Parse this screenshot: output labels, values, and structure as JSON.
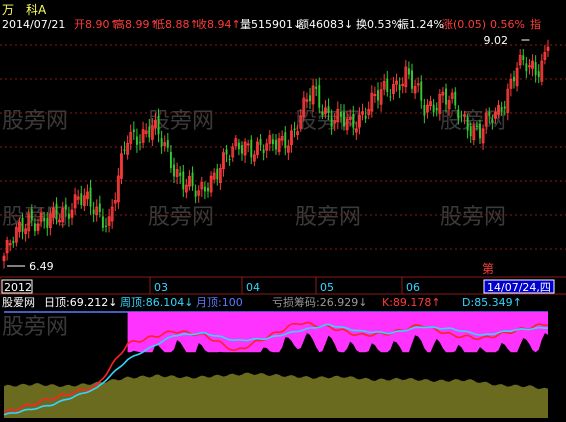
{
  "window": {
    "app_glyph": "万",
    "title": "科A"
  },
  "header": {
    "date": "2014/07/21",
    "items": [
      {
        "label": "开",
        "value": "8.90",
        "arrow": "↑",
        "color": "#ff3b3b"
      },
      {
        "label": "高",
        "value": "8.99",
        "arrow": "↑",
        "color": "#ff3b3b"
      },
      {
        "label": "低",
        "value": "8.88",
        "arrow": "↑",
        "color": "#ff3b3b"
      },
      {
        "label": "收",
        "value": "8.94",
        "arrow": "↑",
        "color": "#ff3b3b"
      },
      {
        "label": "量",
        "value": "515901",
        "arrow": "↓",
        "color": "#ffffff"
      },
      {
        "label": "额",
        "value": "46083",
        "arrow": "↓",
        "color": "#ffffff"
      },
      {
        "label": "换",
        "value": "0.53%",
        "arrow": "",
        "color": "#ffffff"
      },
      {
        "label": "振",
        "value": "1.24%",
        "arrow": "",
        "color": "#ffffff"
      },
      {
        "label": "涨",
        "value": "(0.05)",
        "arrow": "",
        "color": "#ff3b3b"
      },
      {
        "label": "",
        "value": "0.56%",
        "arrow": "",
        "color": "#ff3b3b"
      },
      {
        "label": "指",
        "value": "",
        "arrow": "",
        "color": "#ff3b3b"
      }
    ]
  },
  "price_panel": {
    "high_label": "9.02",
    "low_label": "6.49",
    "watermark": "股旁网"
  },
  "time_axis": {
    "labels": [
      {
        "text": "2012",
        "boxed": true
      },
      {
        "text": "03",
        "boxed": false
      },
      {
        "text": "04",
        "boxed": false
      },
      {
        "text": "05",
        "boxed": false
      },
      {
        "text": "06",
        "boxed": false
      }
    ],
    "marker": "第",
    "cursor_date": "14/07/24,四"
  },
  "indicator_header": {
    "name": "股爱网",
    "items": [
      {
        "label": "日顶:",
        "value": "69.212",
        "arrow": "↓",
        "color": "#ffffff"
      },
      {
        "label": "周顶:",
        "value": "86.104",
        "arrow": "↓",
        "color": "#33d6ff"
      },
      {
        "label": "月顶:",
        "value": "100",
        "arrow": "",
        "color": "#5a7bff"
      },
      {
        "label": "亏损筹码:",
        "value": "26.929",
        "arrow": "↓",
        "color": "#9a9a9a"
      },
      {
        "label": "K:",
        "value": "89.178",
        "arrow": "↑",
        "color": "#ff3b3b"
      },
      {
        "label": "D:",
        "value": "85.349",
        "arrow": "↑",
        "color": "#33d6ff"
      }
    ]
  },
  "colors": {
    "background": "#000000",
    "up_candle": "#ff3b3b",
    "down_candle": "#33cc33",
    "grid": "#8b1a1a",
    "axis": "#8b1a1a",
    "k_line": "#ff2222",
    "d_line": "#33d6ff",
    "magenta_area": "#ff33ff",
    "yellow_band": "#ffff00",
    "olive_area": "#6b6b1f",
    "top_line": "#5a7bff",
    "watermark": "#3a3a3a"
  },
  "chart_data": {
    "type": "candlestick",
    "period": "daily",
    "price_range": [
      6.49,
      9.02
    ],
    "anchor_points": [
      {
        "i": 0,
        "close": 6.6
      },
      {
        "i": 8,
        "close": 7.05
      },
      {
        "i": 14,
        "close": 6.95
      },
      {
        "i": 24,
        "close": 7.25
      },
      {
        "i": 34,
        "close": 7.0
      },
      {
        "i": 40,
        "close": 7.9
      },
      {
        "i": 48,
        "close": 8.05
      },
      {
        "i": 55,
        "close": 7.6
      },
      {
        "i": 63,
        "close": 7.25
      },
      {
        "i": 70,
        "close": 7.65
      },
      {
        "i": 78,
        "close": 7.85
      },
      {
        "i": 86,
        "close": 7.8
      },
      {
        "i": 94,
        "close": 8.0
      },
      {
        "i": 100,
        "close": 8.45
      },
      {
        "i": 106,
        "close": 8.15
      },
      {
        "i": 112,
        "close": 8.05
      },
      {
        "i": 118,
        "close": 8.3
      },
      {
        "i": 124,
        "close": 8.45
      },
      {
        "i": 130,
        "close": 8.65
      },
      {
        "i": 136,
        "close": 8.25
      },
      {
        "i": 142,
        "close": 8.4
      },
      {
        "i": 148,
        "close": 8.15
      },
      {
        "i": 154,
        "close": 8.0
      },
      {
        "i": 160,
        "close": 8.2
      },
      {
        "i": 166,
        "close": 8.75
      },
      {
        "i": 172,
        "close": 8.65
      },
      {
        "i": 176,
        "close": 8.94
      }
    ],
    "indicator": {
      "name": "股爱网",
      "scale": [
        0,
        100
      ],
      "k_line": [
        {
          "i": 0,
          "v": 5
        },
        {
          "i": 15,
          "v": 18
        },
        {
          "i": 30,
          "v": 30
        },
        {
          "i": 40,
          "v": 70
        },
        {
          "i": 55,
          "v": 82
        },
        {
          "i": 65,
          "v": 78
        },
        {
          "i": 75,
          "v": 63
        },
        {
          "i": 85,
          "v": 76
        },
        {
          "i": 95,
          "v": 90
        },
        {
          "i": 105,
          "v": 86
        },
        {
          "i": 115,
          "v": 78
        },
        {
          "i": 125,
          "v": 80
        },
        {
          "i": 135,
          "v": 88
        },
        {
          "i": 145,
          "v": 78
        },
        {
          "i": 155,
          "v": 75
        },
        {
          "i": 165,
          "v": 82
        },
        {
          "i": 176,
          "v": 89.178
        }
      ],
      "d_line": [
        {
          "i": 0,
          "v": 3
        },
        {
          "i": 15,
          "v": 12
        },
        {
          "i": 30,
          "v": 28
        },
        {
          "i": 40,
          "v": 55
        },
        {
          "i": 55,
          "v": 78
        },
        {
          "i": 65,
          "v": 80
        },
        {
          "i": 75,
          "v": 73
        },
        {
          "i": 85,
          "v": 75
        },
        {
          "i": 95,
          "v": 82
        },
        {
          "i": 105,
          "v": 88
        },
        {
          "i": 115,
          "v": 82
        },
        {
          "i": 125,
          "v": 80
        },
        {
          "i": 135,
          "v": 86
        },
        {
          "i": 145,
          "v": 84
        },
        {
          "i": 155,
          "v": 78
        },
        {
          "i": 165,
          "v": 83
        },
        {
          "i": 176,
          "v": 85.349
        }
      ],
      "loss_chips": [
        {
          "i": 0,
          "v": 30
        },
        {
          "i": 10,
          "v": 32
        },
        {
          "i": 20,
          "v": 30
        },
        {
          "i": 30,
          "v": 33
        },
        {
          "i": 40,
          "v": 38
        },
        {
          "i": 50,
          "v": 40
        },
        {
          "i": 60,
          "v": 38
        },
        {
          "i": 70,
          "v": 40
        },
        {
          "i": 80,
          "v": 42
        },
        {
          "i": 90,
          "v": 40
        },
        {
          "i": 100,
          "v": 38
        },
        {
          "i": 110,
          "v": 39
        },
        {
          "i": 120,
          "v": 36
        },
        {
          "i": 130,
          "v": 37
        },
        {
          "i": 140,
          "v": 35
        },
        {
          "i": 150,
          "v": 36
        },
        {
          "i": 160,
          "v": 31
        },
        {
          "i": 170,
          "v": 30
        },
        {
          "i": 176,
          "v": 26.929
        }
      ]
    }
  }
}
